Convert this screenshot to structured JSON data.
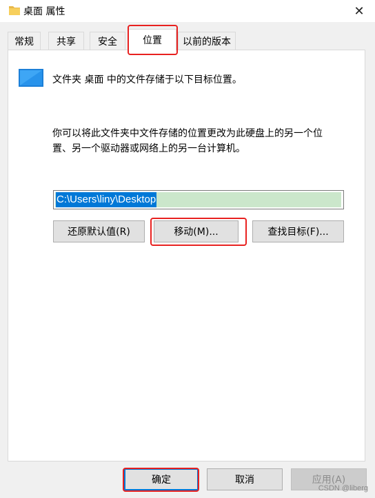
{
  "window": {
    "title": "桌面 属性",
    "close_icon": "close-icon",
    "folder_icon": "folder-icon",
    "close_glyph": "✕"
  },
  "tabs": [
    {
      "label": "常规",
      "active": false
    },
    {
      "label": "共享",
      "active": false
    },
    {
      "label": "安全",
      "active": false
    },
    {
      "label": "位置",
      "active": true
    },
    {
      "label": "以前的版本",
      "active": false
    }
  ],
  "location": {
    "description": "文件夹 桌面 中的文件存储于以下目标位置。",
    "info_line1": "你可以将此文件夹中文件存储的位置更改为此硬盘上的另一个位",
    "info_line2": "置、另一个驱动器或网络上的另一台计算机。",
    "path_value": "C:\\Users\\liny\\Desktop",
    "restore_default_label": "还原默认值(R)",
    "move_label": "移动(M)...",
    "find_target_label": "查找目标(F)..."
  },
  "footer": {
    "ok_label": "确定",
    "cancel_label": "取消",
    "apply_label": "应用(A)"
  },
  "watermark": "CSDN @liberg",
  "colors": {
    "highlight": "#e8201f",
    "accent": "#0078d7",
    "selection": "#cbe7cb"
  }
}
